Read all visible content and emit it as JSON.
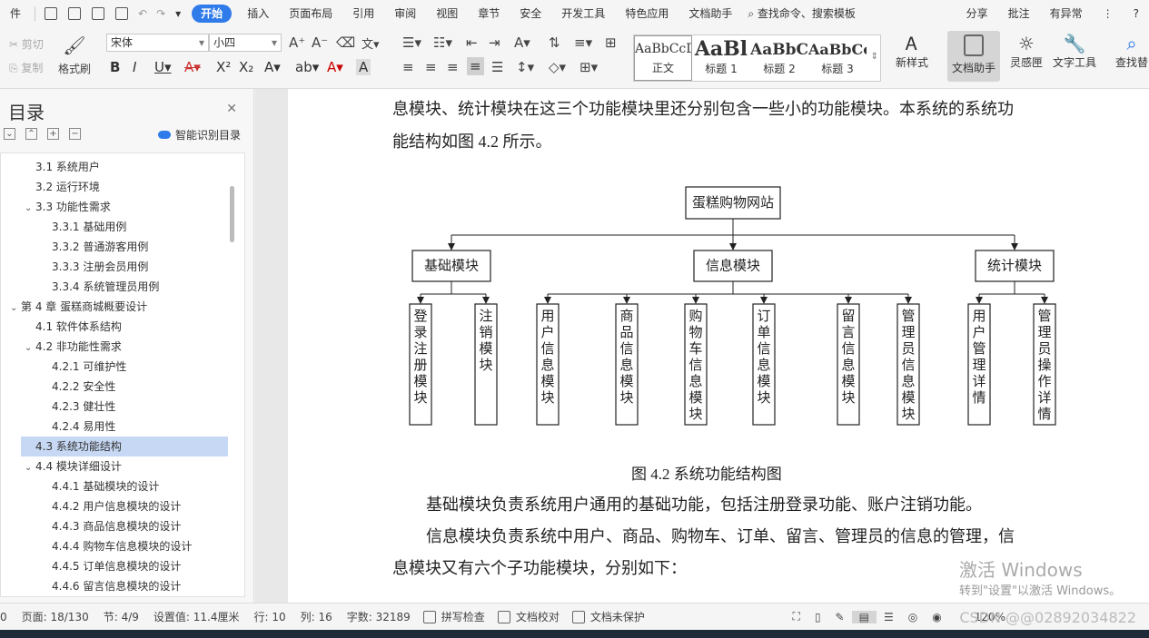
{
  "menubar": {
    "file": "件",
    "items": [
      "开始",
      "插入",
      "页面布局",
      "引用",
      "审阅",
      "视图",
      "章节",
      "安全",
      "开发工具",
      "特色应用",
      "文档助手"
    ],
    "search": "查找命令、搜索模板",
    "right": [
      "分享",
      "批注",
      "有异常"
    ]
  },
  "ribbon": {
    "cut": "剪切",
    "copy": "复制",
    "format_painter": "格式刷",
    "font_name": "宋体",
    "font_size": "小四",
    "styles": [
      {
        "sample": "AaBbCcDd",
        "label": "正文"
      },
      {
        "sample": "AaBl",
        "label": "标题 1"
      },
      {
        "sample": "AaBbCc",
        "label": "标题 2"
      },
      {
        "sample": "AaBbCc",
        "label": "标题 3"
      }
    ],
    "new_style": "新样式",
    "doc_assistant": "文档助手",
    "inspiration": "灵感匣",
    "text_tools": "文字工具",
    "find_replace": "查找替"
  },
  "nav": {
    "title": "目录",
    "smart": "智能识别目录",
    "items": [
      {
        "text": "3.1 系统用户",
        "level": 2
      },
      {
        "text": "3.2 运行环境",
        "level": 2
      },
      {
        "text": "3.3 功能性需求",
        "level": 2,
        "expanded": true
      },
      {
        "text": "3.3.1 基础用例",
        "level": 3
      },
      {
        "text": "3.3.2 普通游客用例",
        "level": 3
      },
      {
        "text": "3.3.3 注册会员用例",
        "level": 3
      },
      {
        "text": "3.3.4 系统管理员用例",
        "level": 3
      },
      {
        "text": "第 4 章 蛋糕商城概要设计",
        "level": 1,
        "expanded": true
      },
      {
        "text": "4.1 软件体系结构",
        "level": 2
      },
      {
        "text": "4.2 非功能性需求",
        "level": 2,
        "expanded": true
      },
      {
        "text": "4.2.1 可维护性",
        "level": 3
      },
      {
        "text": "4.2.2 安全性",
        "level": 3
      },
      {
        "text": "4.2.3 健壮性",
        "level": 3
      },
      {
        "text": "4.2.4 易用性",
        "level": 3
      },
      {
        "text": "4.3 系统功能结构",
        "level": 2,
        "selected": true
      },
      {
        "text": "4.4 模块详细设计",
        "level": 2,
        "expanded": true
      },
      {
        "text": "4.4.1 基础模块的设计",
        "level": 3
      },
      {
        "text": "4.4.2 用户信息模块的设计",
        "level": 3
      },
      {
        "text": "4.4.3 商品信息模块的设计",
        "level": 3
      },
      {
        "text": "4.4.4 购物车信息模块的设计",
        "level": 3
      },
      {
        "text": "4.4.5 订单信息模块的设计",
        "level": 3
      },
      {
        "text": "4.4.6 留言信息模块的设计",
        "level": 3
      }
    ]
  },
  "doc": {
    "line1": "息模块、统计模块在这三个功能模块里还分别包含一些小的功能模块。本系统的系统功",
    "line2": "能结构如图 4.2 所示。",
    "caption": "图 4.2  系统功能结构图",
    "p1": "基础模块负责系统用户通用的基础功能，包括注册登录功能、账户注销功能。",
    "p2a": "信息模块负责系统中用户、商品、购物车、订单、留言、管理员的信息的管理，信",
    "p2b": "息模块又有六个子功能模块，分别如下："
  },
  "diagram": {
    "root": "蛋糕购物网站",
    "groups": [
      {
        "name": "基础模块",
        "children": [
          "登录注册模块",
          "注销模块"
        ]
      },
      {
        "name": "信息模块",
        "children": [
          "用户信息模块",
          "商品信息模块",
          "购物车信息模块",
          "订单信息模块",
          "留言信息模块",
          "管理员信息模块"
        ]
      },
      {
        "name": "统计模块",
        "children": [
          "用户管理详情",
          "管理员操作详情"
        ]
      }
    ]
  },
  "watermark": {
    "line1": "激活 Windows",
    "line2": "转到\"设置\"以激活 Windows。"
  },
  "status": {
    "page": "页面: 18/130",
    "section": "节: 4/9",
    "setting": "设置值: 11.4厘米",
    "row": "行: 10",
    "col": "列: 16",
    "words": "字数: 32189",
    "spell": "拼写检查",
    "proof": "文档校对",
    "protect": "文档未保护",
    "zoom": "120%"
  },
  "csdn": "CSDN @@02892034822"
}
